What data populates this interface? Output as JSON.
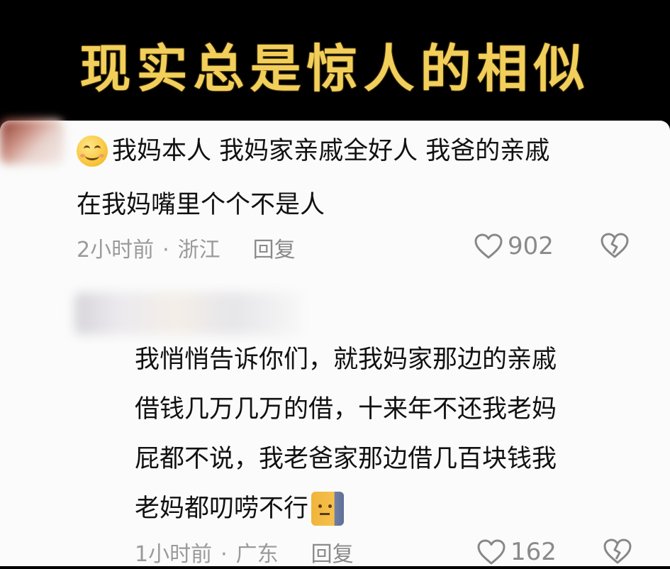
{
  "banner": {
    "title": "现实总是惊人的相似"
  },
  "comment1": {
    "line1": "我妈本人 我妈家亲戚全好人 我爸的亲戚",
    "line2": "在我妈嘴里个个不是人",
    "emoji": "smiley-icon",
    "time": "2小时前",
    "separator": "·",
    "location": "浙江",
    "reply_label": "回复",
    "likes": "902"
  },
  "comment2": {
    "line1": "我悄悄告诉你们，就我妈家那边的亲戚",
    "line2": "借钱几万几万的借，十来年不还我老妈",
    "line3": "屁都不说，我老爸家那边借几百块钱我",
    "line4": "老妈都叨唠不行",
    "emoji": "dog-icon",
    "time": "1小时前",
    "separator": "·",
    "location": "广东",
    "reply_label": "回复",
    "likes": "162"
  },
  "colors": {
    "banner_text": "#f2cf5b",
    "background_dark": "#000000",
    "panel": "#fbfbfb",
    "meta_text": "#9a9a9a"
  }
}
